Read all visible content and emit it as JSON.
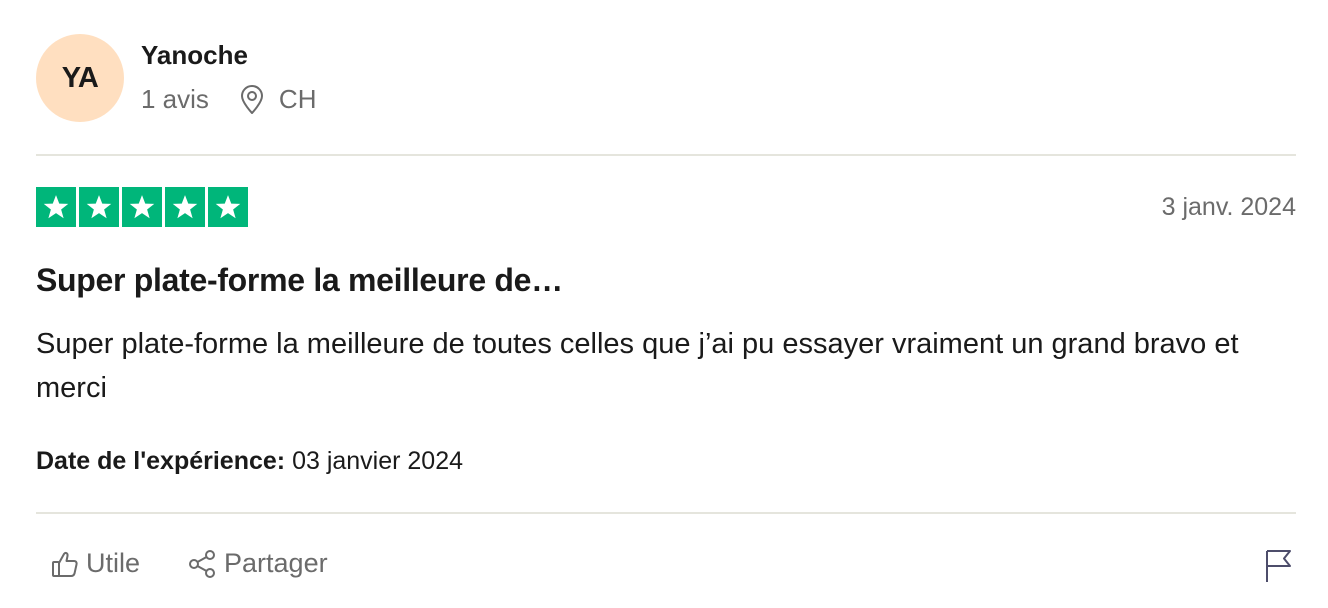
{
  "reviewer": {
    "initials": "YA",
    "name": "Yanoche",
    "review_count": "1 avis",
    "country": "CH",
    "avatar_color": "#ffdfc0"
  },
  "review": {
    "rating": 5,
    "max_rating": 5,
    "star_color": "#00b67a",
    "date": "3 janv. 2024",
    "title": "Super plate-forme la meilleure de…",
    "body": "Super plate-forme la meilleure de toutes celles que j’ai pu essayer vraiment un grand bravo et merci",
    "experience_label": "Date de l'expérience:",
    "experience_date": "03 janvier 2024"
  },
  "actions": {
    "useful_label": "Utile",
    "share_label": "Partager",
    "useful_icon": "thumbs-up-icon",
    "share_icon": "share-icon",
    "report_icon": "flag-icon",
    "location_icon": "location-pin-icon"
  }
}
